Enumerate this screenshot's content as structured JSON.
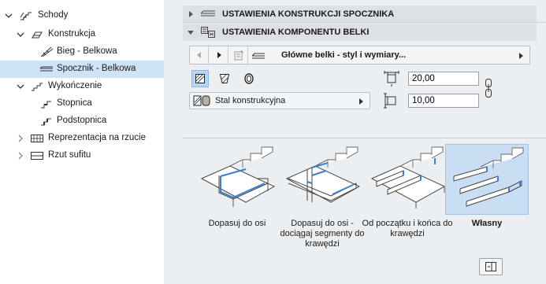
{
  "tree": {
    "items": [
      {
        "label": "Schody"
      },
      {
        "label": "Konstrukcja"
      },
      {
        "label": "Bieg - Belkowa"
      },
      {
        "label": "Spocznik - Belkowa"
      },
      {
        "label": "Wykończenie"
      },
      {
        "label": "Stopnica"
      },
      {
        "label": "Podstopnica"
      },
      {
        "label": "Reprezentacja na rzucie"
      },
      {
        "label": "Rzut sufitu"
      }
    ],
    "selected_item": "Spocznik - Belkowa"
  },
  "panel": {
    "section1_title": "USTAWIENIA KONSTRUKCJI SPOCZNIKA",
    "section2_title": "USTAWIENIA KOMPONENTU BELKI",
    "nav_title": "Główne belki - styl i wymiary...",
    "material_label": "Stal konstrukcyjna",
    "width_value": "20,00",
    "height_value": "10,00",
    "options": [
      {
        "label": "Dopasuj do osi"
      },
      {
        "label": "Dopasuj do osi - dociągaj segmenty do krawędzi"
      },
      {
        "label": "Od początku i końca do krawędzi"
      },
      {
        "label": "Własny"
      }
    ],
    "selected_option": "Własny"
  },
  "colors": {
    "selection": "#cfe3f7",
    "beam_highlight": "#3b7fd4",
    "header_bg": "#dde1e5"
  }
}
